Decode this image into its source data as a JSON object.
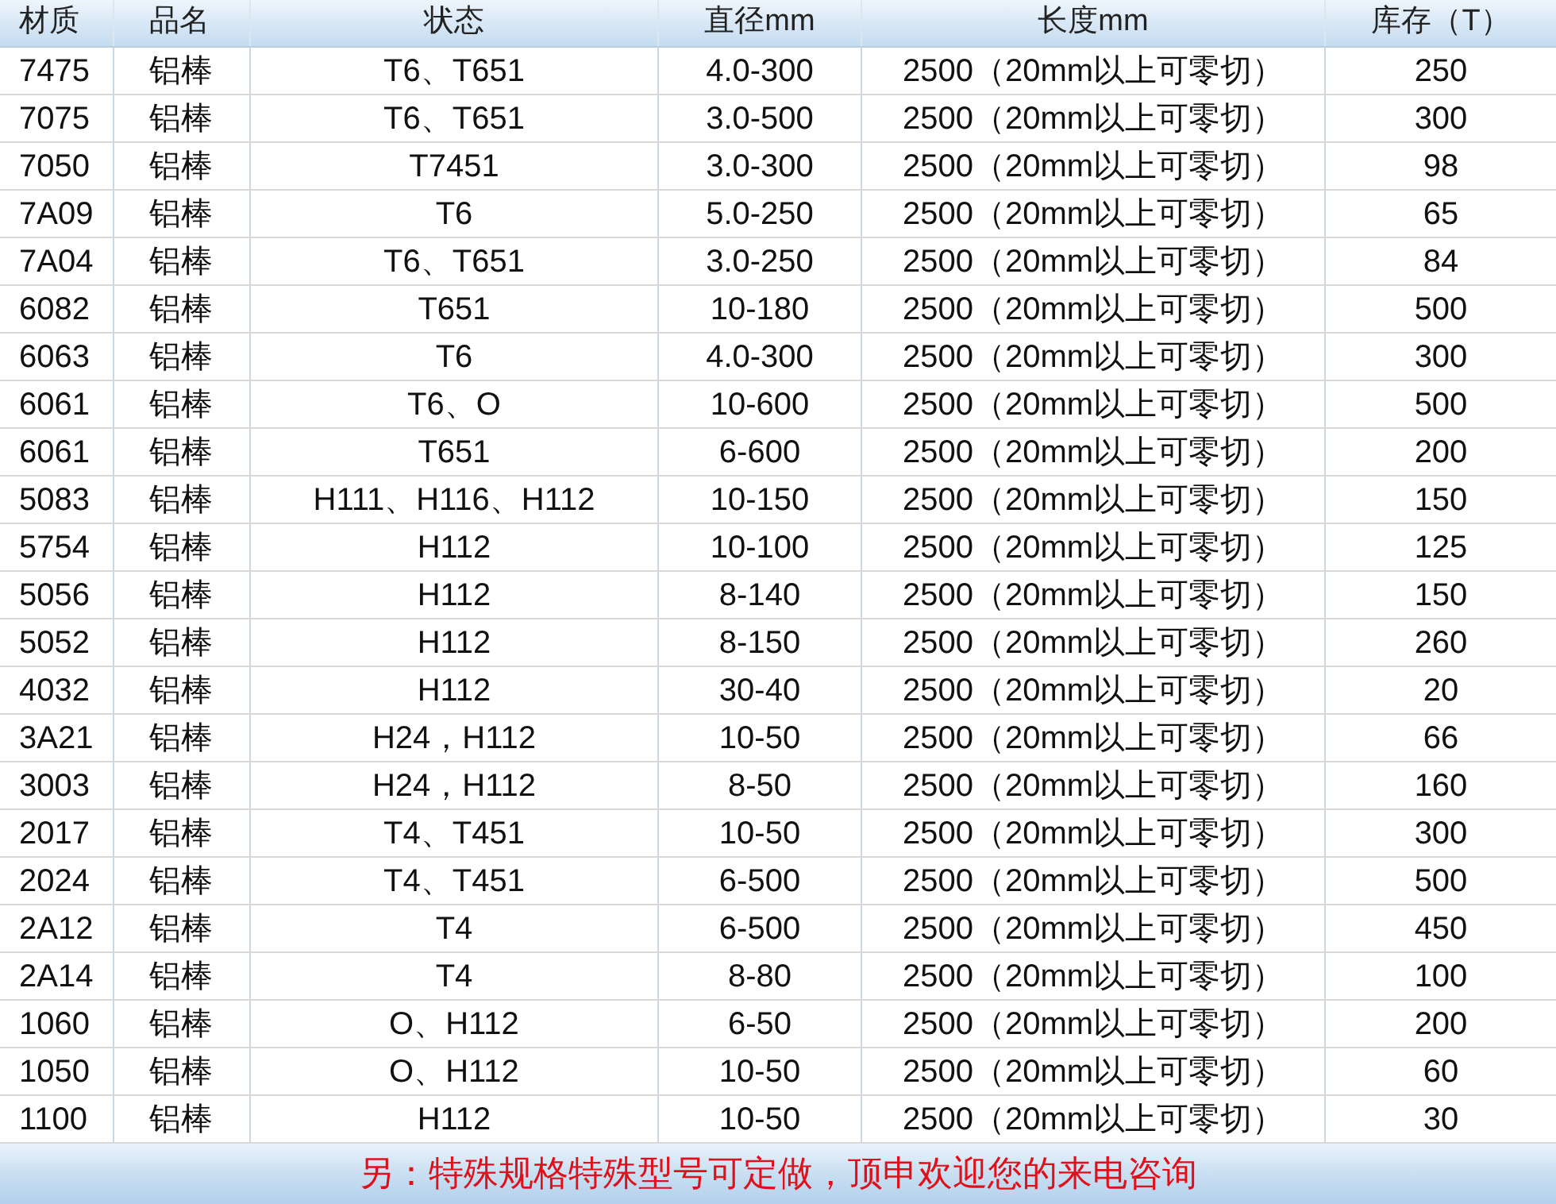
{
  "table": {
    "columns": [
      "材质",
      "品名",
      "状态",
      "直径mm",
      "长度mm",
      "库存（T）"
    ],
    "rows": [
      [
        "7475",
        "铝棒",
        "T6、T651",
        "4.0-300",
        "2500（20mm以上可零切）",
        "250"
      ],
      [
        "7075",
        "铝棒",
        "T6、T651",
        "3.0-500",
        "2500（20mm以上可零切）",
        "300"
      ],
      [
        "7050",
        "铝棒",
        "T7451",
        "3.0-300",
        "2500（20mm以上可零切）",
        "98"
      ],
      [
        "7A09",
        "铝棒",
        "T6",
        "5.0-250",
        "2500（20mm以上可零切）",
        "65"
      ],
      [
        "7A04",
        "铝棒",
        "T6、T651",
        "3.0-250",
        "2500（20mm以上可零切）",
        "84"
      ],
      [
        "6082",
        "铝棒",
        "T651",
        "10-180",
        "2500（20mm以上可零切）",
        "500"
      ],
      [
        "6063",
        "铝棒",
        "T6",
        "4.0-300",
        "2500（20mm以上可零切）",
        "300"
      ],
      [
        "6061",
        "铝棒",
        "T6、O",
        "10-600",
        "2500（20mm以上可零切）",
        "500"
      ],
      [
        "6061",
        "铝棒",
        "T651",
        "6-600",
        "2500（20mm以上可零切）",
        "200"
      ],
      [
        "5083",
        "铝棒",
        "H111、H116、H112",
        "10-150",
        "2500（20mm以上可零切）",
        "150"
      ],
      [
        "5754",
        "铝棒",
        "H112",
        "10-100",
        "2500（20mm以上可零切）",
        "125"
      ],
      [
        "5056",
        "铝棒",
        "H112",
        "8-140",
        "2500（20mm以上可零切）",
        "150"
      ],
      [
        "5052",
        "铝棒",
        "H112",
        "8-150",
        "2500（20mm以上可零切）",
        "260"
      ],
      [
        "4032",
        "铝棒",
        "H112",
        "30-40",
        "2500（20mm以上可零切）",
        "20"
      ],
      [
        "3A21",
        "铝棒",
        "H24，H112",
        "10-50",
        "2500（20mm以上可零切）",
        "66"
      ],
      [
        "3003",
        "铝棒",
        "H24，H112",
        "8-50",
        "2500（20mm以上可零切）",
        "160"
      ],
      [
        "2017",
        "铝棒",
        "T4、T451",
        "10-50",
        "2500（20mm以上可零切）",
        "300"
      ],
      [
        "2024",
        "铝棒",
        "T4、T451",
        "6-500",
        "2500（20mm以上可零切）",
        "500"
      ],
      [
        "2A12",
        "铝棒",
        "T4",
        "6-500",
        "2500（20mm以上可零切）",
        "450"
      ],
      [
        "2A14",
        "铝棒",
        "T4",
        "8-80",
        "2500（20mm以上可零切）",
        "100"
      ],
      [
        "1060",
        "铝棒",
        "O、H112",
        "6-50",
        "2500（20mm以上可零切）",
        "200"
      ],
      [
        "1050",
        "铝棒",
        "O、H112",
        "10-50",
        "2500（20mm以上可零切）",
        "60"
      ],
      [
        "1100",
        "铝棒",
        "H112",
        "10-50",
        "2500（20mm以上可零切）",
        "30"
      ]
    ]
  },
  "footer_note": "另：特殊规格特殊型号可定做，顶申欢迎您的来电咨询"
}
